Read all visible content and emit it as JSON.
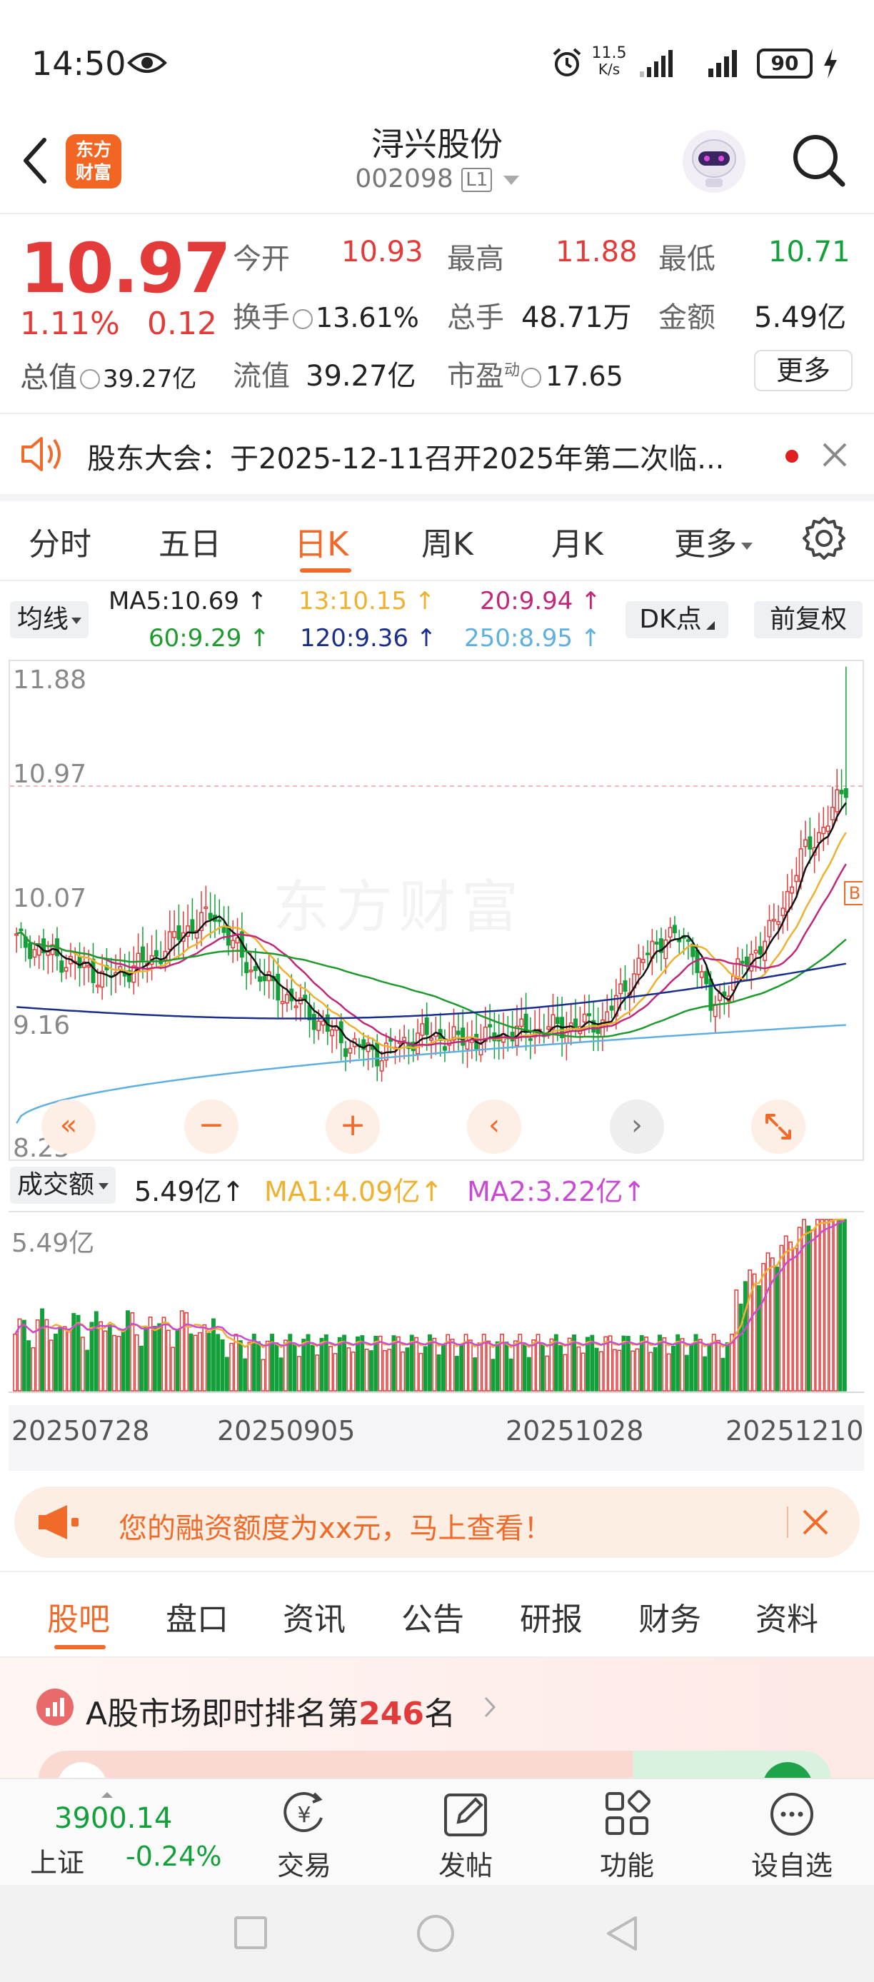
{
  "status_bar": {
    "time": "14:50",
    "net_speed_value": "11.5",
    "net_speed_unit": "K/s",
    "battery": "90"
  },
  "header": {
    "logo_line1": "东方",
    "logo_line2": "财富",
    "title": "浔兴股份",
    "code": "002098",
    "level": "L1"
  },
  "quote": {
    "price": "10.97",
    "change_pct": "1.11%",
    "change": "0.12",
    "total_value_label": "总值",
    "total_value": "39.27亿",
    "open_label": "今开",
    "open": "10.93",
    "high_label": "最高",
    "high": "11.88",
    "low_label": "最低",
    "low": "10.71",
    "turnover_label": "换手",
    "turnover": "13.61%",
    "volume_label": "总手",
    "volume": "48.71万",
    "amount_label": "金额",
    "amount": "5.49亿",
    "float_label": "流值",
    "float": "39.27亿",
    "pe_label": "市盈",
    "pe_sup": "动",
    "pe": "17.65",
    "more_button": "更多"
  },
  "notice": {
    "text": "股东大会：于2025-12-11召开2025年第二次临..."
  },
  "period_tabs": [
    "分时",
    "五日",
    "日K",
    "周K",
    "月K",
    "更多"
  ],
  "active_tab_index": 2,
  "ma_bar": {
    "selector": "均线",
    "ma5": "MA5:10.69",
    "ma13": "13:10.15",
    "ma20": "20:9.94",
    "ma60": "60:9.29",
    "ma120": "120:9.36",
    "ma250": "250:8.95",
    "dk_button": "DK点",
    "adjust_button": "前复权"
  },
  "kchart": {
    "y_labels": [
      "11.88",
      "10.97",
      "10.07",
      "9.16",
      "8.25"
    ],
    "watermark": "东方财富",
    "b_marker": "B"
  },
  "volume_bar": {
    "selector": "成交额",
    "value": "5.49亿",
    "ma1": "MA1:4.09亿",
    "ma2": "MA2:3.22亿",
    "max_label": "5.49亿"
  },
  "x_dates": [
    "20250728",
    "20250905",
    "20251028",
    "20251210"
  ],
  "chart_data": {
    "type": "candlestick",
    "ylim": [
      8.25,
      11.88
    ],
    "last_close": 10.97,
    "moving_averages": {
      "MA5": 10.69,
      "MA13": 10.15,
      "MA20": 9.94,
      "MA60": 9.29,
      "MA120": 9.36,
      "MA250": 8.95
    },
    "volume": {
      "latest": "5.49亿",
      "MA1": "4.09亿",
      "MA2": "3.22亿"
    },
    "x_ticks": [
      "20250728",
      "20250905",
      "20251028",
      "20251210"
    ]
  },
  "promo": {
    "text": "您的融资额度为xx元，马上查看！"
  },
  "bottom_tabs": [
    "股吧",
    "盘口",
    "资讯",
    "公告",
    "研报",
    "财务",
    "资料"
  ],
  "rank": {
    "prefix": "A股市场即时排名第",
    "number": "246",
    "suffix": "名"
  },
  "footer": {
    "index_value": "3900.14",
    "index_name": "上证",
    "index_change": "-0.24%",
    "trade": "交易",
    "post": "发帖",
    "function": "功能",
    "watchlist": "设自选"
  },
  "colors": {
    "up": "#e33a3a",
    "down": "#13a03b",
    "accent": "#f06a2a",
    "ma5": "#111111",
    "ma13": "#f0b030",
    "ma20": "#c0287a",
    "ma60": "#1e9a2e",
    "ma120": "#1a2e8c",
    "ma250": "#5fb0e0"
  }
}
